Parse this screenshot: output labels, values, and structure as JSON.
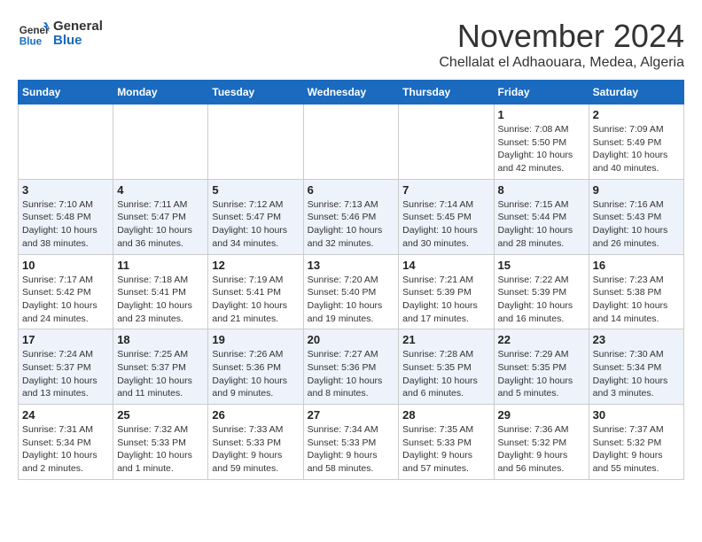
{
  "header": {
    "logo_line1": "General",
    "logo_line2": "Blue",
    "month_title": "November 2024",
    "subtitle": "Chellalat el Adhaouara, Medea, Algeria"
  },
  "weekdays": [
    "Sunday",
    "Monday",
    "Tuesday",
    "Wednesday",
    "Thursday",
    "Friday",
    "Saturday"
  ],
  "weeks": [
    [
      {
        "day": "",
        "info": ""
      },
      {
        "day": "",
        "info": ""
      },
      {
        "day": "",
        "info": ""
      },
      {
        "day": "",
        "info": ""
      },
      {
        "day": "",
        "info": ""
      },
      {
        "day": "1",
        "info": "Sunrise: 7:08 AM\nSunset: 5:50 PM\nDaylight: 10 hours\nand 42 minutes."
      },
      {
        "day": "2",
        "info": "Sunrise: 7:09 AM\nSunset: 5:49 PM\nDaylight: 10 hours\nand 40 minutes."
      }
    ],
    [
      {
        "day": "3",
        "info": "Sunrise: 7:10 AM\nSunset: 5:48 PM\nDaylight: 10 hours\nand 38 minutes."
      },
      {
        "day": "4",
        "info": "Sunrise: 7:11 AM\nSunset: 5:47 PM\nDaylight: 10 hours\nand 36 minutes."
      },
      {
        "day": "5",
        "info": "Sunrise: 7:12 AM\nSunset: 5:47 PM\nDaylight: 10 hours\nand 34 minutes."
      },
      {
        "day": "6",
        "info": "Sunrise: 7:13 AM\nSunset: 5:46 PM\nDaylight: 10 hours\nand 32 minutes."
      },
      {
        "day": "7",
        "info": "Sunrise: 7:14 AM\nSunset: 5:45 PM\nDaylight: 10 hours\nand 30 minutes."
      },
      {
        "day": "8",
        "info": "Sunrise: 7:15 AM\nSunset: 5:44 PM\nDaylight: 10 hours\nand 28 minutes."
      },
      {
        "day": "9",
        "info": "Sunrise: 7:16 AM\nSunset: 5:43 PM\nDaylight: 10 hours\nand 26 minutes."
      }
    ],
    [
      {
        "day": "10",
        "info": "Sunrise: 7:17 AM\nSunset: 5:42 PM\nDaylight: 10 hours\nand 24 minutes."
      },
      {
        "day": "11",
        "info": "Sunrise: 7:18 AM\nSunset: 5:41 PM\nDaylight: 10 hours\nand 23 minutes."
      },
      {
        "day": "12",
        "info": "Sunrise: 7:19 AM\nSunset: 5:41 PM\nDaylight: 10 hours\nand 21 minutes."
      },
      {
        "day": "13",
        "info": "Sunrise: 7:20 AM\nSunset: 5:40 PM\nDaylight: 10 hours\nand 19 minutes."
      },
      {
        "day": "14",
        "info": "Sunrise: 7:21 AM\nSunset: 5:39 PM\nDaylight: 10 hours\nand 17 minutes."
      },
      {
        "day": "15",
        "info": "Sunrise: 7:22 AM\nSunset: 5:39 PM\nDaylight: 10 hours\nand 16 minutes."
      },
      {
        "day": "16",
        "info": "Sunrise: 7:23 AM\nSunset: 5:38 PM\nDaylight: 10 hours\nand 14 minutes."
      }
    ],
    [
      {
        "day": "17",
        "info": "Sunrise: 7:24 AM\nSunset: 5:37 PM\nDaylight: 10 hours\nand 13 minutes."
      },
      {
        "day": "18",
        "info": "Sunrise: 7:25 AM\nSunset: 5:37 PM\nDaylight: 10 hours\nand 11 minutes."
      },
      {
        "day": "19",
        "info": "Sunrise: 7:26 AM\nSunset: 5:36 PM\nDaylight: 10 hours\nand 9 minutes."
      },
      {
        "day": "20",
        "info": "Sunrise: 7:27 AM\nSunset: 5:36 PM\nDaylight: 10 hours\nand 8 minutes."
      },
      {
        "day": "21",
        "info": "Sunrise: 7:28 AM\nSunset: 5:35 PM\nDaylight: 10 hours\nand 6 minutes."
      },
      {
        "day": "22",
        "info": "Sunrise: 7:29 AM\nSunset: 5:35 PM\nDaylight: 10 hours\nand 5 minutes."
      },
      {
        "day": "23",
        "info": "Sunrise: 7:30 AM\nSunset: 5:34 PM\nDaylight: 10 hours\nand 3 minutes."
      }
    ],
    [
      {
        "day": "24",
        "info": "Sunrise: 7:31 AM\nSunset: 5:34 PM\nDaylight: 10 hours\nand 2 minutes."
      },
      {
        "day": "25",
        "info": "Sunrise: 7:32 AM\nSunset: 5:33 PM\nDaylight: 10 hours\nand 1 minute."
      },
      {
        "day": "26",
        "info": "Sunrise: 7:33 AM\nSunset: 5:33 PM\nDaylight: 9 hours\nand 59 minutes."
      },
      {
        "day": "27",
        "info": "Sunrise: 7:34 AM\nSunset: 5:33 PM\nDaylight: 9 hours\nand 58 minutes."
      },
      {
        "day": "28",
        "info": "Sunrise: 7:35 AM\nSunset: 5:33 PM\nDaylight: 9 hours\nand 57 minutes."
      },
      {
        "day": "29",
        "info": "Sunrise: 7:36 AM\nSunset: 5:32 PM\nDaylight: 9 hours\nand 56 minutes."
      },
      {
        "day": "30",
        "info": "Sunrise: 7:37 AM\nSunset: 5:32 PM\nDaylight: 9 hours\nand 55 minutes."
      }
    ]
  ]
}
